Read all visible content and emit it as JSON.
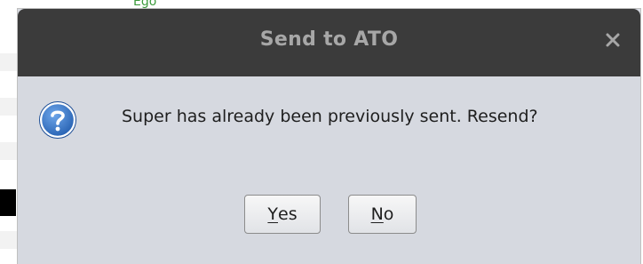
{
  "background": {
    "partial_text": "Ego"
  },
  "dialog": {
    "title": "Send to ATO",
    "close_icon": "close-icon",
    "message_icon": "question-icon",
    "message": "Super has already been previously sent. Resend?",
    "buttons": {
      "yes": {
        "mnemonic": "Y",
        "rest": "es"
      },
      "no": {
        "mnemonic": "N",
        "rest": "o"
      }
    }
  },
  "colors": {
    "titlebar": "#3b3b3b",
    "title_text": "#a7a7a7",
    "dialog_body": "#d6d9e0",
    "question_icon": "#2f6fc0"
  }
}
